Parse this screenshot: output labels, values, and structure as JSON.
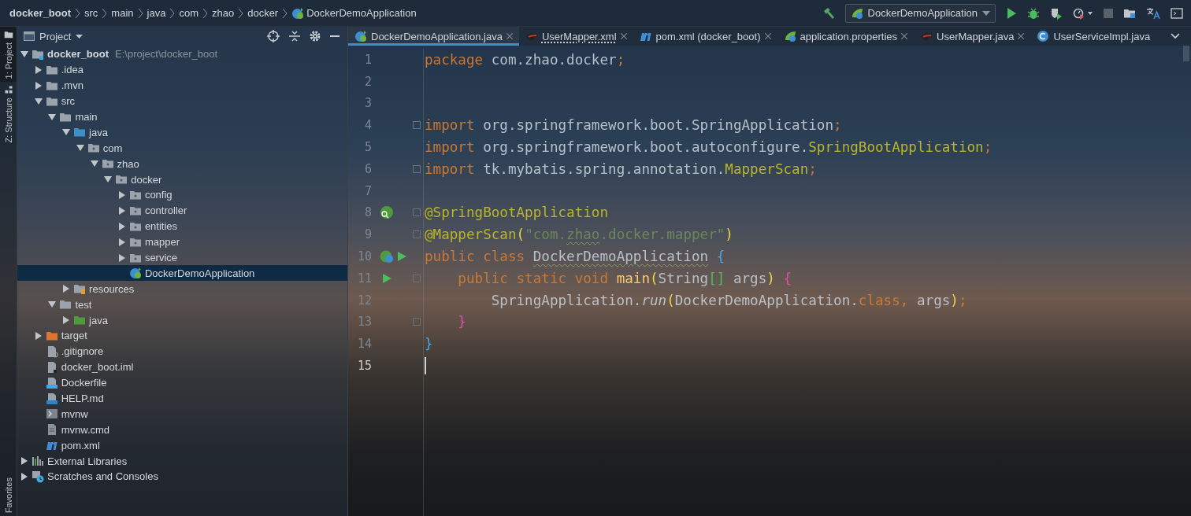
{
  "breadcrumbs": [
    {
      "label": "docker_boot",
      "kind": "project"
    },
    {
      "label": "src",
      "kind": "dir"
    },
    {
      "label": "main",
      "kind": "dir"
    },
    {
      "label": "java",
      "kind": "dir"
    },
    {
      "label": "com",
      "kind": "dir"
    },
    {
      "label": "zhao",
      "kind": "dir"
    },
    {
      "label": "docker",
      "kind": "dir"
    },
    {
      "label": "DockerDemoApplication",
      "kind": "spring-class"
    }
  ],
  "run_config": {
    "label": "DockerDemoApplication"
  },
  "side_strip": {
    "top": [
      "1: Project",
      "Z: Structure"
    ],
    "bottom": [
      "Favorites"
    ]
  },
  "project_panel": {
    "title": "Project",
    "tree": [
      {
        "label": "docker_boot",
        "path": "E:\\project\\docker_boot",
        "kind": "module",
        "expanded": true,
        "selected": false,
        "children": [
          {
            "label": ".idea",
            "kind": "folder",
            "expanded": false,
            "selected": false
          },
          {
            "label": ".mvn",
            "kind": "folder",
            "expanded": false,
            "selected": false
          },
          {
            "label": "src",
            "kind": "folder",
            "expanded": true,
            "selected": false,
            "children": [
              {
                "label": "main",
                "kind": "folder",
                "expanded": true,
                "selected": false,
                "children": [
                  {
                    "label": "java",
                    "kind": "source-folder",
                    "expanded": true,
                    "selected": false,
                    "children": [
                      {
                        "label": "com",
                        "kind": "package",
                        "expanded": true,
                        "selected": false,
                        "children": [
                          {
                            "label": "zhao",
                            "kind": "package",
                            "expanded": true,
                            "selected": false,
                            "children": [
                              {
                                "label": "docker",
                                "kind": "package",
                                "expanded": true,
                                "selected": false,
                                "children": [
                                  {
                                    "label": "config",
                                    "kind": "package",
                                    "expanded": false,
                                    "selected": false
                                  },
                                  {
                                    "label": "controller",
                                    "kind": "package",
                                    "expanded": false,
                                    "selected": false
                                  },
                                  {
                                    "label": "entities",
                                    "kind": "package",
                                    "expanded": false,
                                    "selected": false
                                  },
                                  {
                                    "label": "mapper",
                                    "kind": "package",
                                    "expanded": false,
                                    "selected": false
                                  },
                                  {
                                    "label": "service",
                                    "kind": "package",
                                    "expanded": false,
                                    "selected": false
                                  },
                                  {
                                    "label": "DockerDemoApplication",
                                    "kind": "spring-class",
                                    "selected": true
                                  }
                                ]
                              }
                            ]
                          }
                        ]
                      }
                    ]
                  },
                  {
                    "label": "resources",
                    "kind": "resources-folder",
                    "expanded": false,
                    "selected": false
                  }
                ]
              },
              {
                "label": "test",
                "kind": "folder",
                "expanded": true,
                "selected": false,
                "children": [
                  {
                    "label": "java",
                    "kind": "test-folder",
                    "expanded": false,
                    "selected": false
                  }
                ]
              }
            ]
          },
          {
            "label": "target",
            "kind": "excluded-folder",
            "expanded": false,
            "selected": false
          },
          {
            "label": ".gitignore",
            "kind": "ignore-file",
            "selected": false
          },
          {
            "label": "docker_boot.iml",
            "kind": "iml-file",
            "selected": false
          },
          {
            "label": "Dockerfile",
            "kind": "docker-file",
            "selected": false
          },
          {
            "label": "HELP.md",
            "kind": "md-file",
            "selected": false
          },
          {
            "label": "mvnw",
            "kind": "shell-file",
            "selected": false
          },
          {
            "label": "mvnw.cmd",
            "kind": "text-file",
            "selected": false
          },
          {
            "label": "pom.xml",
            "kind": "maven-file",
            "selected": false
          }
        ]
      },
      {
        "label": "External Libraries",
        "kind": "libraries",
        "expanded": false,
        "selected": false
      },
      {
        "label": "Scratches and Consoles",
        "kind": "scratches",
        "expanded": false,
        "selected": false
      }
    ]
  },
  "tabs": [
    {
      "label": "DockerDemoApplication.java",
      "kind": "spring-class",
      "selected": true,
      "closable": true,
      "underline": false
    },
    {
      "label": "UserMapper.xml",
      "kind": "mybatis",
      "selected": false,
      "closable": true,
      "underline": true
    },
    {
      "label": "pom.xml (docker_boot)",
      "kind": "maven",
      "selected": false,
      "closable": true,
      "underline": false
    },
    {
      "label": "application.properties",
      "kind": "spring-leaf",
      "selected": false,
      "closable": true,
      "underline": false
    },
    {
      "label": "UserMapper.java",
      "kind": "mybatis",
      "selected": false,
      "closable": true,
      "underline": false
    },
    {
      "label": "UserServiceImpl.java",
      "kind": "class",
      "selected": false,
      "closable": false,
      "underline": false
    }
  ],
  "editor": {
    "lines": [
      {
        "number": "1",
        "fold": false,
        "caret": false,
        "tokens": [
          {
            "t": "package ",
            "kind": "kw"
          },
          {
            "t": "com.zhao.docker",
            "kind": "id"
          },
          {
            "t": ";",
            "kind": "kw"
          }
        ]
      },
      {
        "number": "2",
        "fold": false,
        "caret": false
      },
      {
        "number": "3",
        "fold": false,
        "caret": false
      },
      {
        "number": "4",
        "fold": true,
        "caret": false,
        "tokens": [
          {
            "t": "import ",
            "kind": "kw"
          },
          {
            "t": "org.springframework.boot.SpringApplication",
            "kind": "id"
          },
          {
            "t": ";",
            "kind": "kw"
          }
        ]
      },
      {
        "number": "5",
        "fold": false,
        "caret": false,
        "tokens": [
          {
            "t": "import ",
            "kind": "kw"
          },
          {
            "t": "org.springframework.boot.autoconfigure.",
            "kind": "id"
          },
          {
            "t": "SpringBootApplication",
            "kind": "ann"
          },
          {
            "t": ";",
            "kind": "kw"
          }
        ]
      },
      {
        "number": "6",
        "fold": true,
        "caret": false,
        "tokens": [
          {
            "t": "import ",
            "kind": "kw"
          },
          {
            "t": "tk.mybatis.spring.annotation.",
            "kind": "id"
          },
          {
            "t": "MapperScan",
            "kind": "ann"
          },
          {
            "t": ";",
            "kind": "kw"
          }
        ]
      },
      {
        "number": "7",
        "fold": false,
        "caret": false
      },
      {
        "number": "8",
        "fold": true,
        "caret": false,
        "gutter": [
          {
            "kind": "bean"
          }
        ],
        "tokens": [
          {
            "t": "@SpringBootApplication",
            "kind": "ann"
          }
        ]
      },
      {
        "number": "9",
        "fold": true,
        "caret": false,
        "tokens": [
          {
            "t": "@MapperScan",
            "kind": "ann"
          },
          {
            "t": "(",
            "kind": "paren"
          },
          {
            "t": "\"com.",
            "kind": "str"
          },
          {
            "t": "zhao",
            "kind": "str",
            "wavy": true
          },
          {
            "t": ".docker.mapper\"",
            "kind": "str"
          },
          {
            "t": ")",
            "kind": "paren"
          }
        ]
      },
      {
        "number": "10",
        "fold": false,
        "caret": false,
        "gutter": [
          {
            "kind": "class"
          },
          {
            "kind": "run"
          }
        ],
        "tokens": [
          {
            "t": "public class ",
            "kind": "kw"
          },
          {
            "t": "DockerDemoApplication",
            "kind": "id",
            "wavy": true
          },
          {
            "t": " {",
            "kind": "brace"
          }
        ]
      },
      {
        "number": "11",
        "fold": true,
        "caret": false,
        "gutter": [
          {
            "kind": "run"
          }
        ],
        "tokens": [
          {
            "t": "    public static void ",
            "kind": "kw"
          },
          {
            "t": "main",
            "kind": "method"
          },
          {
            "t": "(",
            "kind": "paren"
          },
          {
            "t": "String",
            "kind": "id"
          },
          {
            "t": "[]",
            "kind": "bracket"
          },
          {
            "t": " args",
            "kind": "id"
          },
          {
            "t": ")",
            "kind": "paren"
          },
          {
            "t": " {",
            "kind": "brace2"
          }
        ]
      },
      {
        "number": "12",
        "fold": false,
        "caret": false,
        "tokens": [
          {
            "t": "        SpringApplication.",
            "kind": "id"
          },
          {
            "t": "run",
            "kind": "call"
          },
          {
            "t": "(",
            "kind": "paren"
          },
          {
            "t": "DockerDemoApplication.",
            "kind": "id"
          },
          {
            "t": "class",
            "kind": "kw"
          },
          {
            "t": ", ",
            "kind": "kw"
          },
          {
            "t": "args",
            "kind": "id"
          },
          {
            "t": ")",
            "kind": "paren"
          },
          {
            "t": ";",
            "kind": "kw"
          }
        ]
      },
      {
        "number": "13",
        "fold": true,
        "caret": false,
        "tokens": [
          {
            "t": "    }",
            "kind": "brace2"
          }
        ]
      },
      {
        "number": "14",
        "fold": false,
        "caret": false,
        "tokens": [
          {
            "t": "}",
            "kind": "brace"
          }
        ]
      },
      {
        "number": "15",
        "fold": false,
        "caret": true
      }
    ]
  }
}
